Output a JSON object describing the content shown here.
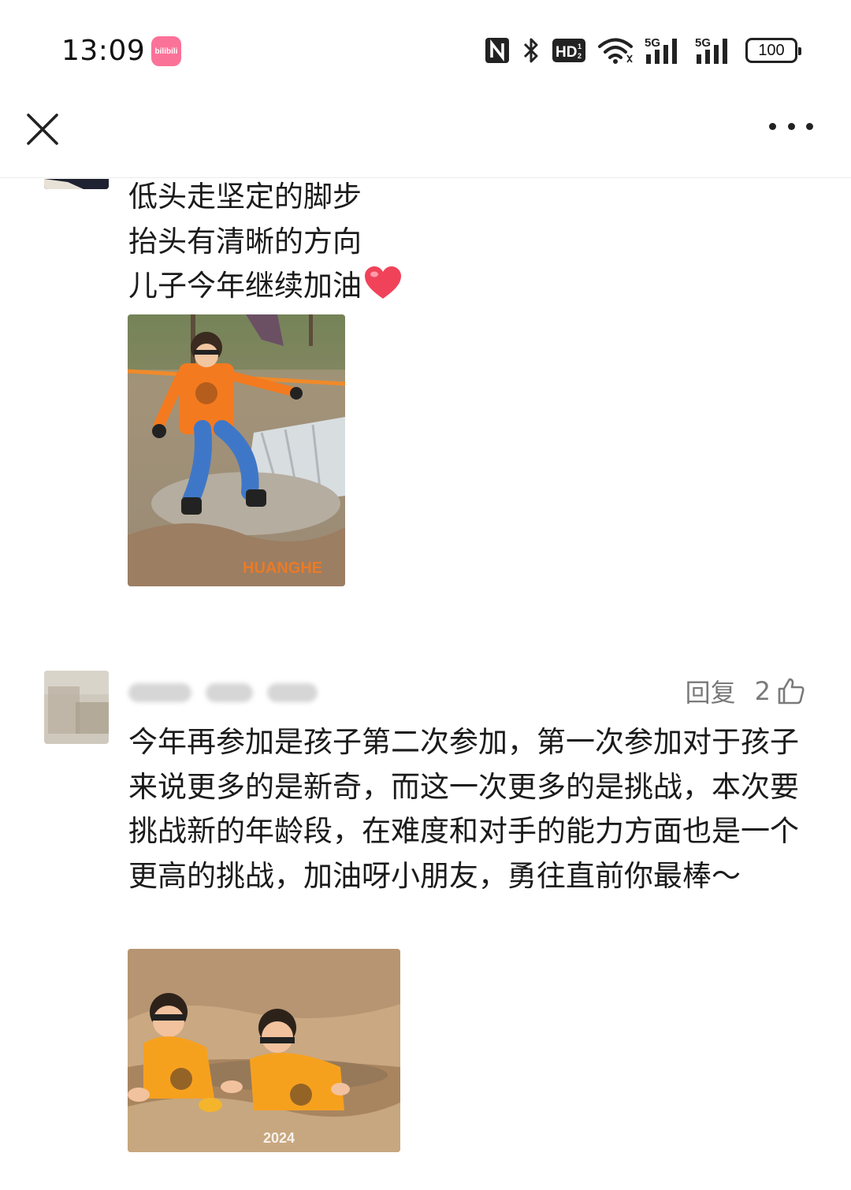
{
  "status_bar": {
    "time": "13:09",
    "app_badge": "bilibili",
    "hd_label": "HD",
    "signal1_label": "5G",
    "signal2_label": "5G",
    "battery_level": "100",
    "icons": [
      "nfc-icon",
      "bluetooth-icon",
      "hd-voice-icon",
      "wifi-icon",
      "signal-5g-icon",
      "signal-5g-icon",
      "battery-icon"
    ]
  },
  "nav": {
    "close_icon": "close-icon",
    "more_icon": "more-dots-icon"
  },
  "comments": [
    {
      "text": "低头走坚定的脚步\n抬头有清晰的方向\n儿子今年继续加油",
      "emoji": "heart",
      "image": "photo-boy-jumping-over-mud-pit"
    },
    {
      "reply_label": "回复",
      "like_count": "2",
      "text": "今年再参加是孩子第二次参加，第一次参加对于孩子来说更多的是新奇，而这一次更多的是挑战，本次要挑战新的年龄段，在难度和对手的能力方面也是一个更高的挑战，加油呀小朋友，勇往直前你最棒～",
      "image": "photo-two-boys-crawling-in-mud"
    }
  ],
  "colors": {
    "accent_pink": "#fb7299",
    "text": "#1b1b1b",
    "muted": "#7a7a7a",
    "heart": "#f0435a"
  }
}
